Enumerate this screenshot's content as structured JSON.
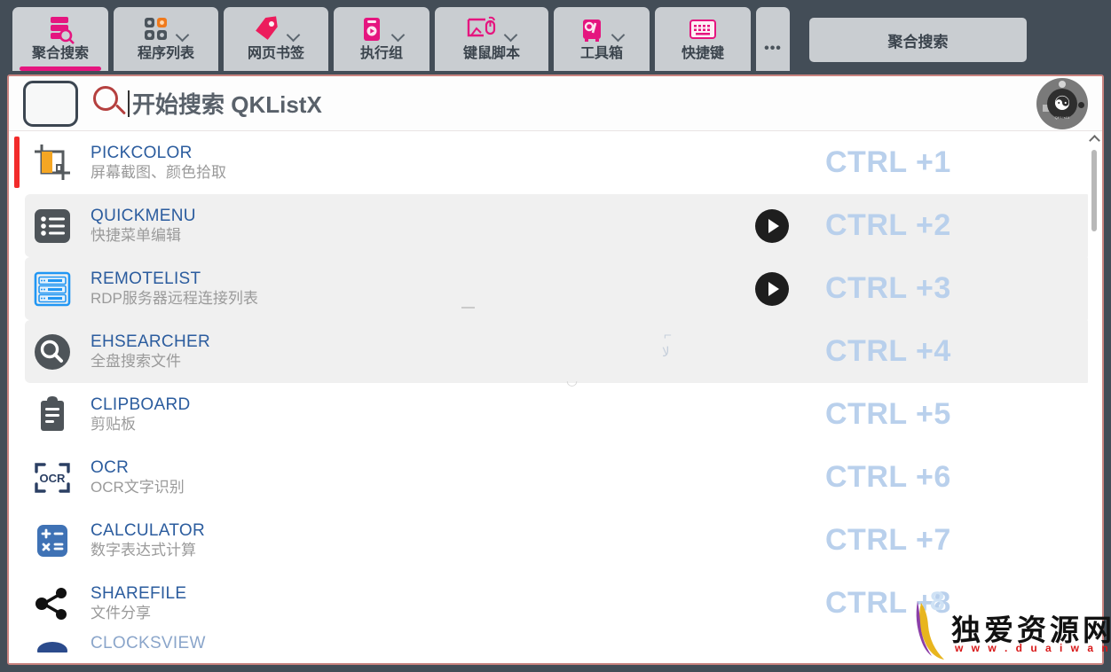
{
  "window": {
    "background": "#434d57",
    "accent_pink": "#e5157f",
    "panel_border": "#c9837f"
  },
  "toolbar": {
    "tabs": [
      {
        "label": "聚合搜索",
        "icon": "database-search-icon",
        "has_dropdown": false,
        "active": true
      },
      {
        "label": "程序列表",
        "icon": "app-grid-icon",
        "has_dropdown": true,
        "active": false
      },
      {
        "label": "网页书签",
        "icon": "bookmark-tag-icon",
        "has_dropdown": true,
        "active": false
      },
      {
        "label": "执行组",
        "icon": "run-group-icon",
        "has_dropdown": true,
        "active": false
      },
      {
        "label": "键鼠脚本",
        "icon": "keyboard-mouse-script-icon",
        "has_dropdown": true,
        "active": false
      },
      {
        "label": "工具箱",
        "icon": "toolbox-icon",
        "has_dropdown": true,
        "active": false
      },
      {
        "label": "快捷键",
        "icon": "keyboard-icon",
        "has_dropdown": false,
        "active": false
      }
    ],
    "overflow_label": "•••",
    "right_button_label": "聚合搜索"
  },
  "search": {
    "placeholder": "开始搜索 QKListX",
    "magnifier_icon": "search-icon",
    "thumbnail_icon": "preview-box",
    "avatar": {
      "icon": "yinyang-avatar-icon",
      "glyph": "☯",
      "caption": "QKListX"
    }
  },
  "list": {
    "items": [
      {
        "name": "PICKCOLOR",
        "desc": "屏幕截图、颜色拾取",
        "shortcut": "CTRL +1",
        "icon": "crop-color-picker-icon",
        "selected": true,
        "alt": false,
        "has_play": false
      },
      {
        "name": "QUICKMENU",
        "desc": "快捷菜单编辑",
        "shortcut": "CTRL +2",
        "icon": "list-menu-icon",
        "selected": false,
        "alt": true,
        "has_play": true
      },
      {
        "name": "REMOTELIST",
        "desc": "RDP服务器远程连接列表",
        "shortcut": "CTRL +3",
        "icon": "server-rack-icon",
        "selected": false,
        "alt": true,
        "has_play": true
      },
      {
        "name": "EHSEARCHER",
        "desc": "全盘搜索文件",
        "shortcut": "CTRL +4",
        "icon": "magnifier-circle-icon",
        "selected": false,
        "alt": true,
        "has_play": false
      },
      {
        "name": "CLIPBOARD",
        "desc": "剪贴板",
        "shortcut": "CTRL +5",
        "icon": "clipboard-icon",
        "selected": false,
        "alt": false,
        "has_play": false
      },
      {
        "name": "OCR",
        "desc": "OCR文字识别",
        "shortcut": "CTRL +6",
        "icon": "ocr-scan-icon",
        "selected": false,
        "alt": false,
        "has_play": false
      },
      {
        "name": "CALCULATOR",
        "desc": "数字表达式计算",
        "shortcut": "CTRL +7",
        "icon": "calculator-icon",
        "selected": false,
        "alt": false,
        "has_play": false
      },
      {
        "name": "SHAREFILE",
        "desc": "文件分享",
        "shortcut": "CTRL +8",
        "icon": "share-nodes-icon",
        "selected": false,
        "alt": false,
        "has_play": false
      }
    ],
    "scrollbar": {
      "up_arrow": "chevron-up-icon"
    }
  },
  "watermark": {
    "text": "独爱资源网",
    "url": "w w w . d u a i w a n g . c",
    "number": "8"
  }
}
